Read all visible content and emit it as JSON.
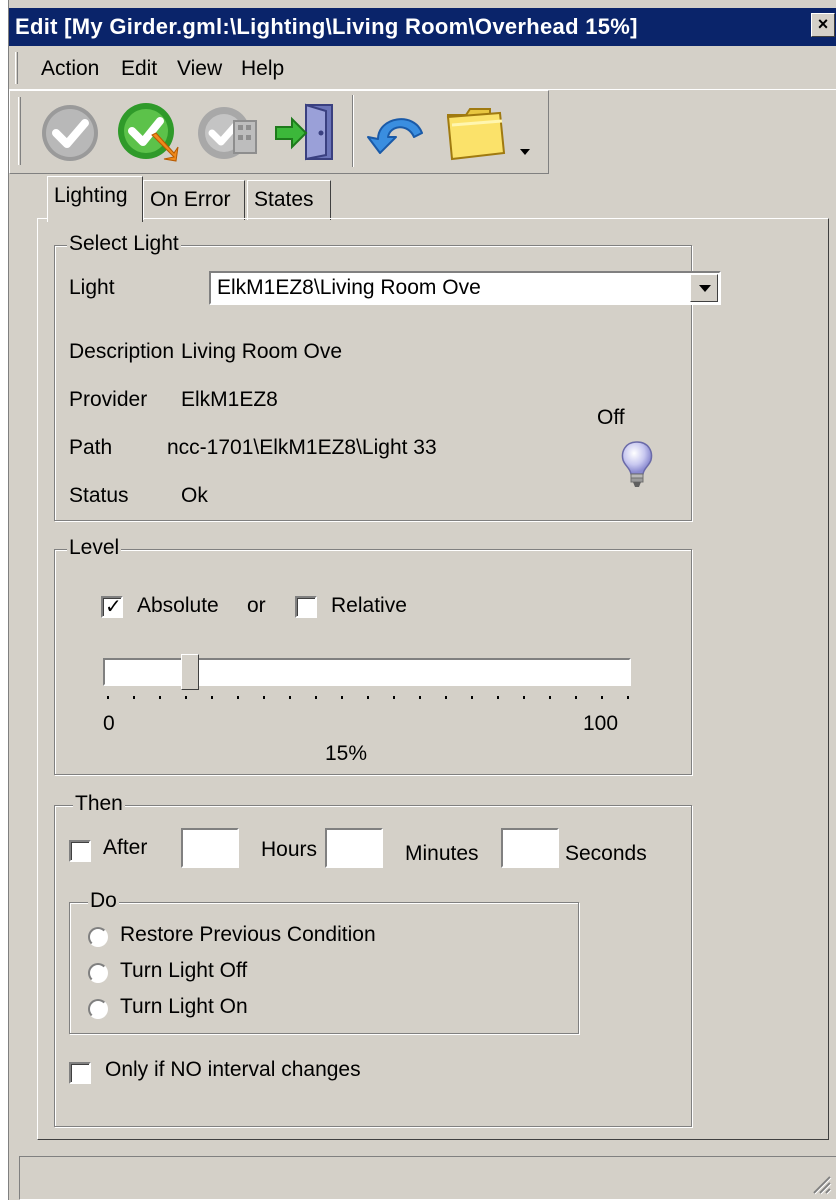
{
  "window": {
    "title": "Edit [My Girder.gml:\\Lighting\\Living Room\\Overhead 15%]"
  },
  "menu": {
    "items": [
      "Action",
      "Edit",
      "View",
      "Help"
    ]
  },
  "toolbar": {
    "icons": [
      "check-disabled-icon",
      "apply-icon",
      "settings-disabled-icon",
      "exit-door-icon",
      "undo-icon",
      "folder-icon"
    ]
  },
  "tabs": [
    "Lighting",
    "On Error",
    "States"
  ],
  "select_light": {
    "group_title": "Select Light",
    "light_label": "Light",
    "light_value": "ElkM1EZ8\\Living Room Ove",
    "description_label": "Description",
    "description_value": "Living Room Ove",
    "provider_label": "Provider",
    "provider_value": "ElkM1EZ8",
    "path_label": "Path",
    "path_value": "ncc-1701\\ElkM1EZ8\\Light 33",
    "status_label": "Status",
    "status_value": "Ok",
    "bulb_state": "Off"
  },
  "level": {
    "group_title": "Level",
    "absolute_label": "Absolute",
    "absolute_checked": true,
    "or_label": "or",
    "relative_label": "Relative",
    "relative_checked": false,
    "slider_value": 15,
    "min_label": "0",
    "max_label": "100",
    "percent_label": "15%"
  },
  "then": {
    "group_title": "Then",
    "after_label": "After",
    "after_checked": false,
    "hours_label": "Hours",
    "minutes_label": "Minutes",
    "seconds_label": "Seconds",
    "hours_value": "",
    "minutes_value": "",
    "seconds_value": "",
    "do": {
      "group_title": "Do",
      "options": [
        "Restore Previous Condition",
        "Turn Light Off",
        "Turn Light On"
      ]
    },
    "interval_label": "Only if NO interval changes",
    "interval_checked": false
  }
}
